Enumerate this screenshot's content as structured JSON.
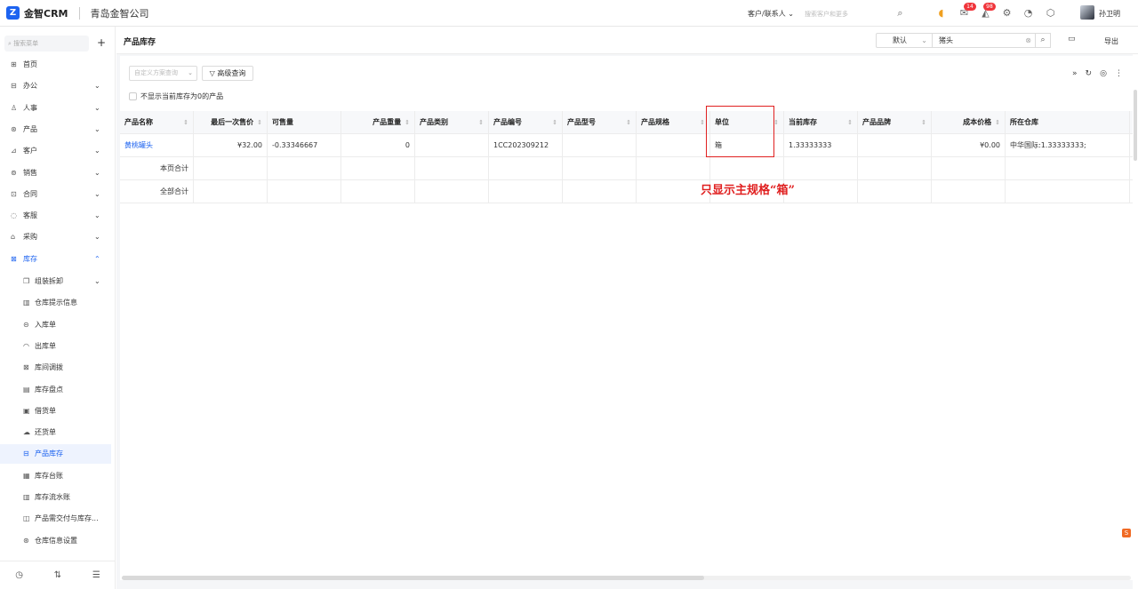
{
  "app": {
    "logo_text": "金智CRM",
    "company": "青岛金智公司"
  },
  "topbar": {
    "search_scope": "客户/联系人",
    "search_placeholder": "搜索客户和更多",
    "badges": {
      "messages": "14",
      "notifications": "98"
    },
    "username": "孙卫明"
  },
  "sidebar": {
    "search_placeholder": "搜索菜单",
    "menu": [
      {
        "label": "首页",
        "icon": "home-icon"
      },
      {
        "label": "办公",
        "icon": "office-icon"
      },
      {
        "label": "人事",
        "icon": "people-icon"
      },
      {
        "label": "产品",
        "icon": "product-icon"
      },
      {
        "label": "客户",
        "icon": "customer-icon"
      },
      {
        "label": "销售",
        "icon": "sales-icon"
      },
      {
        "label": "合同",
        "icon": "contract-icon"
      },
      {
        "label": "客服",
        "icon": "support-icon"
      },
      {
        "label": "采购",
        "icon": "purchase-icon"
      },
      {
        "label": "库存",
        "icon": "inventory-icon"
      }
    ],
    "submenu": [
      {
        "label": "组装拆卸",
        "icon": "assemble-icon"
      },
      {
        "label": "仓库提示信息",
        "icon": "warehouse-tip-icon"
      },
      {
        "label": "入库单",
        "icon": "inbound-icon"
      },
      {
        "label": "出库单",
        "icon": "outbound-icon"
      },
      {
        "label": "库间调拨",
        "icon": "transfer-icon"
      },
      {
        "label": "库存盘点",
        "icon": "stocktake-icon"
      },
      {
        "label": "借货单",
        "icon": "borrow-icon"
      },
      {
        "label": "还货单",
        "icon": "return-icon"
      },
      {
        "label": "产品库存",
        "icon": "product-stock-icon"
      },
      {
        "label": "库存台账",
        "icon": "ledger-icon"
      },
      {
        "label": "库存流水账",
        "icon": "journal-icon"
      },
      {
        "label": "产品需交付与库存...",
        "icon": "delivery-icon"
      },
      {
        "label": "仓库信息设置",
        "icon": "warehouse-settings-icon"
      }
    ]
  },
  "page": {
    "title": "产品库存",
    "view_select": "默认",
    "keyword": "猪头",
    "export_label": "导出",
    "custom_search_placeholder": "自定义方案查询",
    "advanced_search": "高级查询",
    "hide_zero_label": "不显示当前库存为0的产品"
  },
  "table": {
    "columns": [
      "产品名称",
      "最后一次售价",
      "可售量",
      "产品重量",
      "产品类别",
      "产品编号",
      "产品型号",
      "产品规格",
      "单位",
      "当前库存",
      "产品品牌",
      "成本价格",
      "所在仓库"
    ],
    "rows": [
      [
        "黄桃罐头",
        "¥32.00",
        "-0.33346667",
        "0",
        "",
        "1CC202309212",
        "",
        "",
        "箱",
        "1.33333333",
        "",
        "¥0.00",
        "中华国际:1.33333333;"
      ]
    ],
    "page_total_label": "本页合计",
    "all_total_label": "全部合计"
  },
  "annotation": {
    "text": "只显示主规格“箱”",
    "color": "#e02020"
  },
  "colors": {
    "accent": "#1d63f0",
    "badge": "#f0353b"
  }
}
